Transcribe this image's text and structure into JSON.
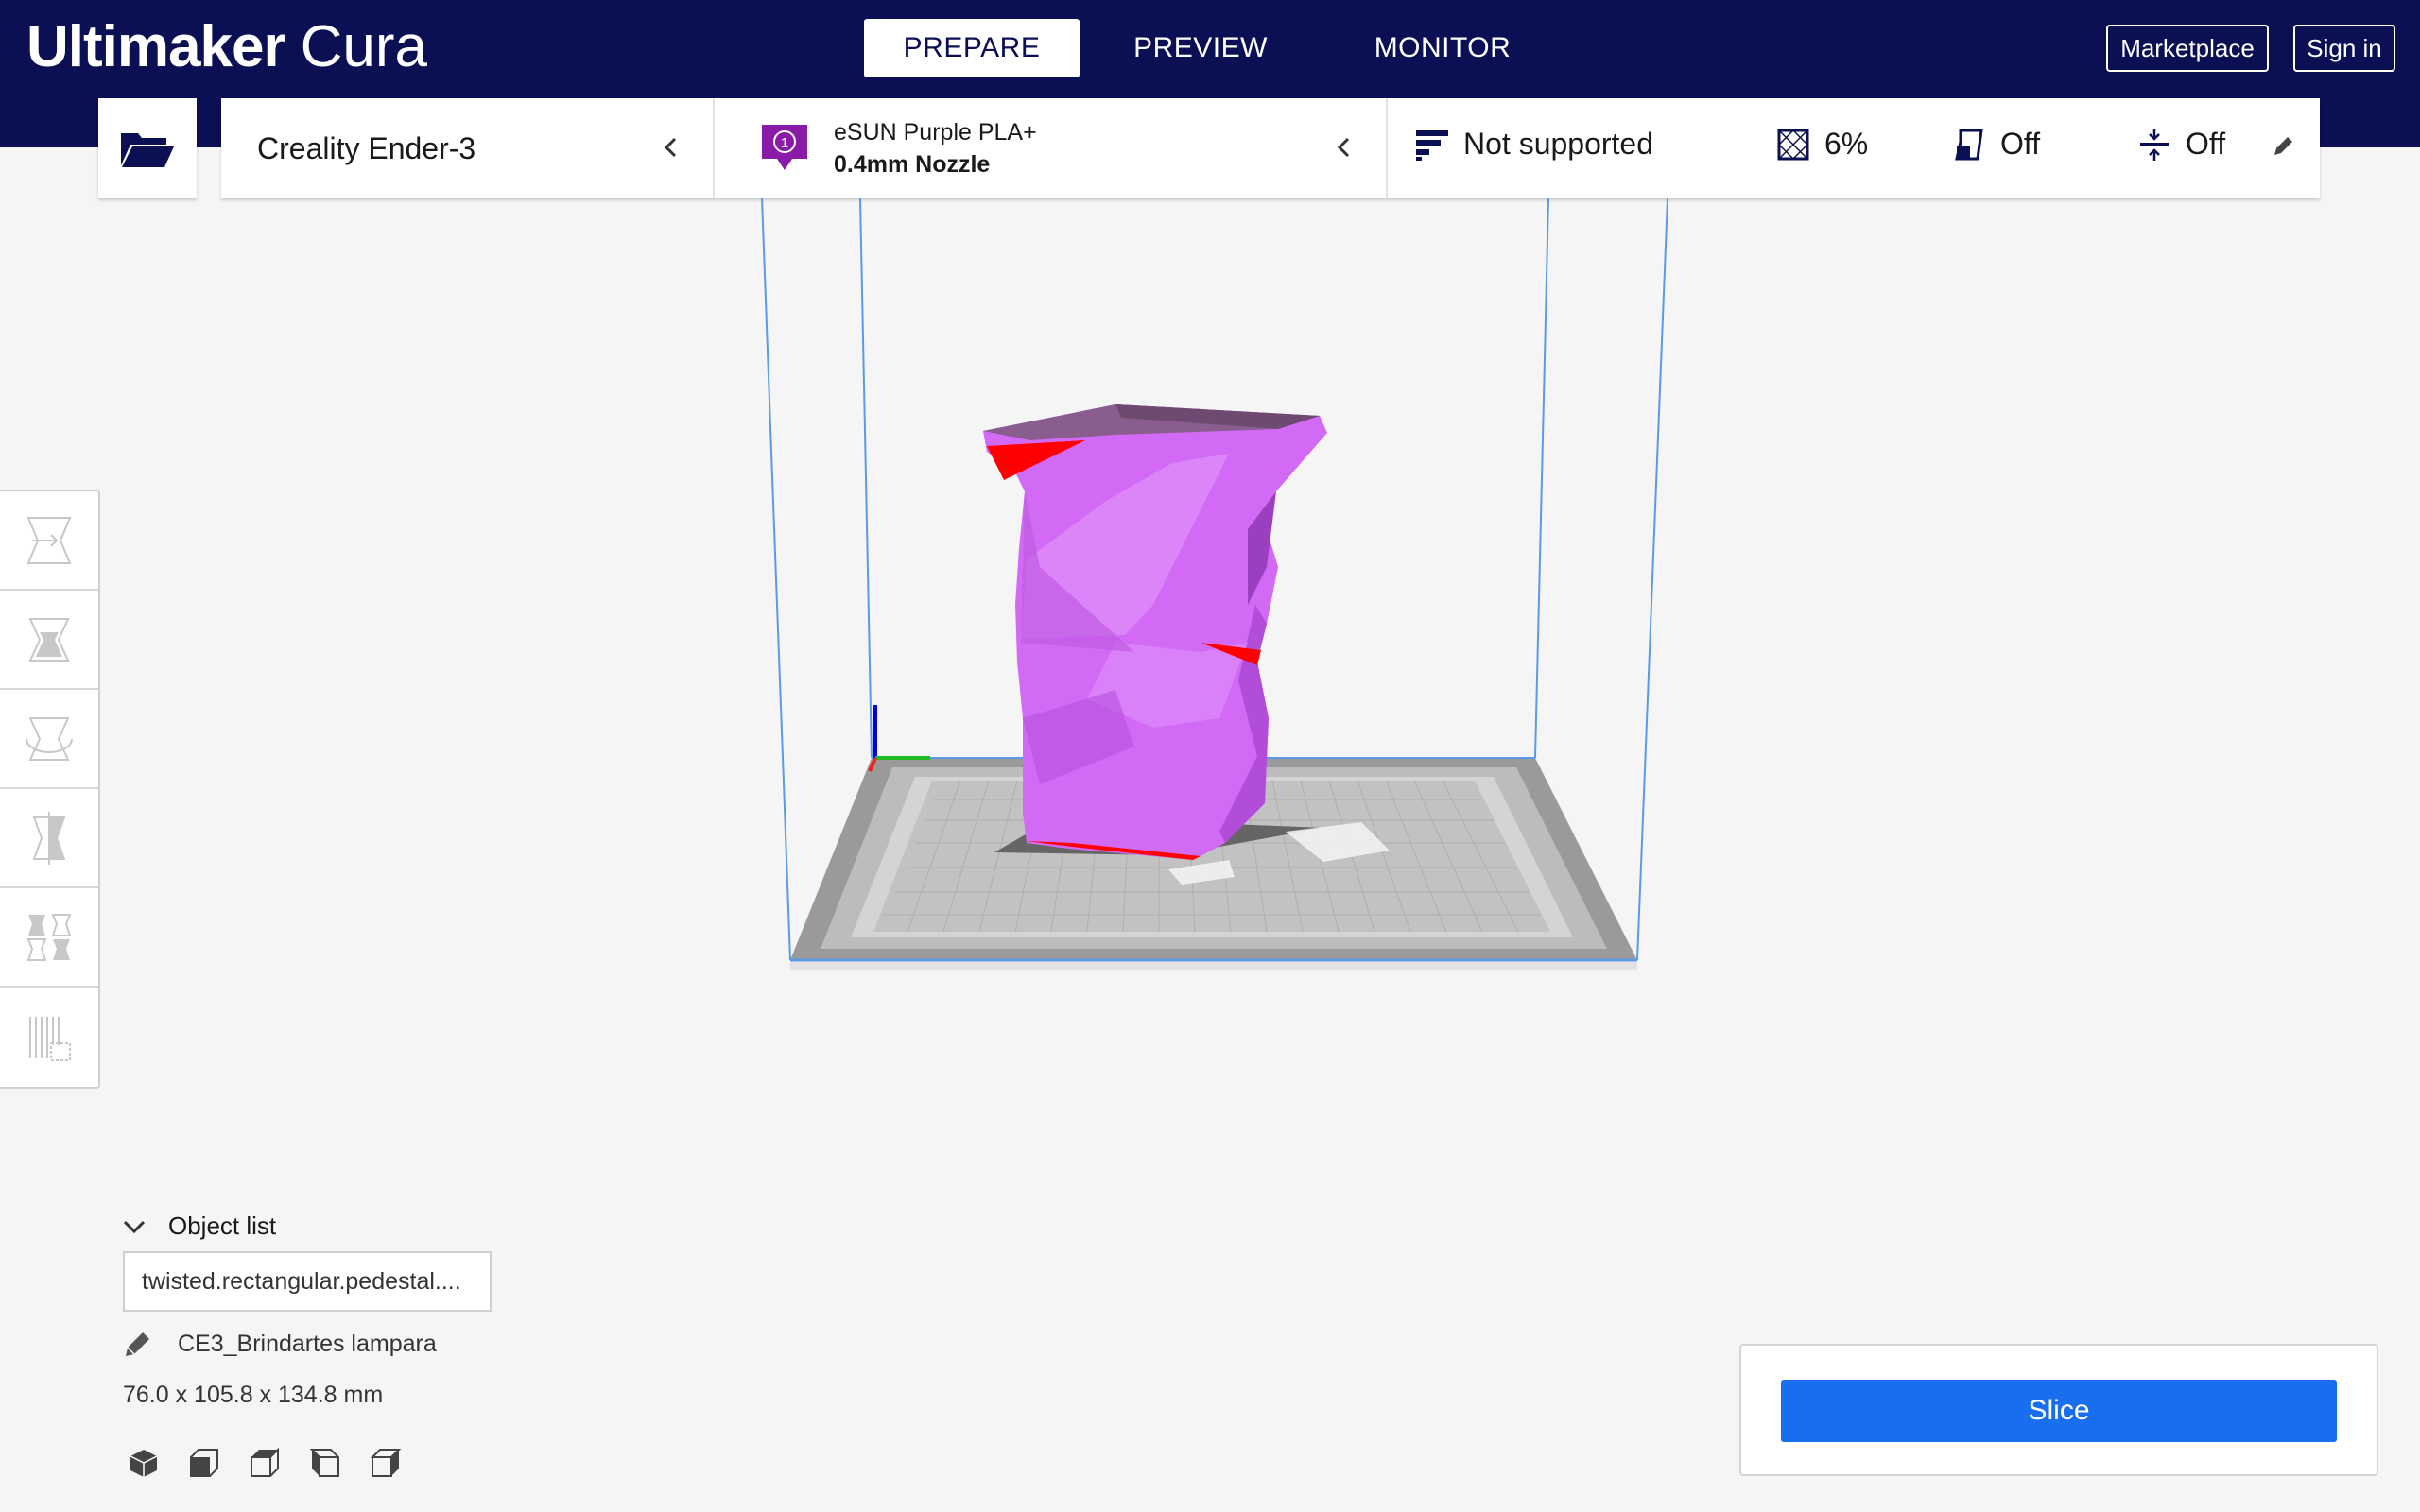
{
  "app": {
    "brand": "Ultimaker",
    "product": "Cura"
  },
  "stages": [
    {
      "label": "PREPARE",
      "active": true
    },
    {
      "label": "PREVIEW",
      "active": false
    },
    {
      "label": "MONITOR",
      "active": false
    }
  ],
  "header_buttons": {
    "marketplace": "Marketplace",
    "sign_in": "Sign in"
  },
  "printer": {
    "name": "Creality Ender-3"
  },
  "material": {
    "extruder": "1",
    "name": "eSUN Purple PLA+",
    "nozzle": "0.4mm Nozzle",
    "color": "#8a1aa8"
  },
  "print_settings": {
    "profile": "Not supported",
    "infill": "6%",
    "support": "Off",
    "adhesion": "Off"
  },
  "tools": [
    "move-tool",
    "scale-tool",
    "rotate-tool",
    "mirror-tool",
    "per-model-settings-tool",
    "support-blocker-tool"
  ],
  "object_list": {
    "header": "Object list",
    "selected_object": "twisted.rectangular.pedestal....",
    "job_name": "CE3_Brindartes lampara",
    "dimensions": "76.0 x 105.8 x 134.8 mm"
  },
  "slice": {
    "label": "Slice",
    "color": "#196ef0"
  },
  "colors": {
    "header_bg": "#0b0f53",
    "model": "#cc5cf0",
    "overhang": "#ff0000",
    "build_volume_edge": "#4a90e0"
  }
}
